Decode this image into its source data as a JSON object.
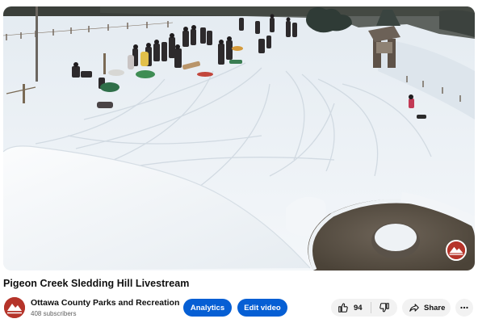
{
  "video": {
    "title": "Pigeon Creek Sledding Hill Livestream"
  },
  "channel": {
    "name": "Ottawa County Parks and Recreation",
    "subscribers": "408 subscribers",
    "brand_color": "#b5342a"
  },
  "actions": {
    "analytics_label": "Analytics",
    "edit_video_label": "Edit video",
    "like_count": "94",
    "share_label": "Share"
  },
  "icons": {
    "like": "thumbs-up-icon",
    "dislike": "thumbs-down-icon",
    "share": "share-arrow-icon",
    "more": "more-horizontal-icon"
  },
  "colors": {
    "primary_button": "#065fd4",
    "secondary_button": "#f2f2f2",
    "subtle_text": "#606060"
  }
}
